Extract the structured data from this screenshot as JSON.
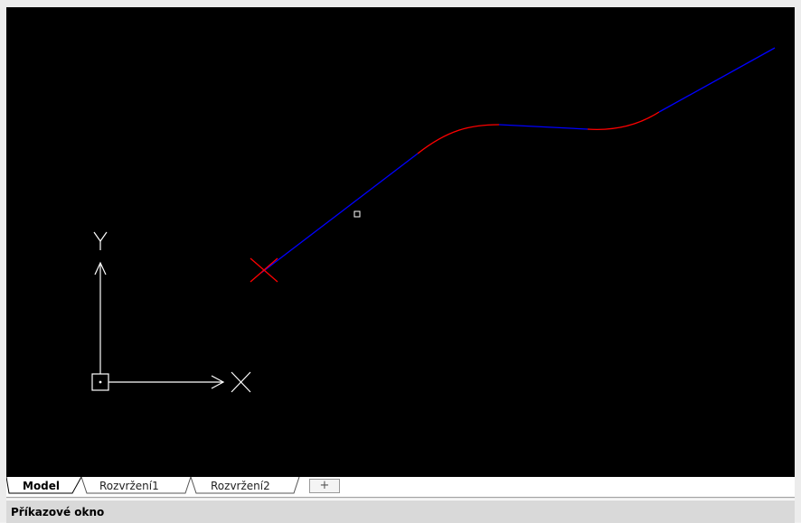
{
  "ucs_icon": {
    "x_label": "X",
    "y_label": "Y"
  },
  "tabs": [
    {
      "label": "Model",
      "active": true
    },
    {
      "label": "Rozvržení1",
      "active": false
    },
    {
      "label": "Rozvržení2",
      "active": false
    }
  ],
  "add_tab_label": "+",
  "command_window": {
    "title": "Příkazové okno"
  },
  "colors": {
    "canvas_bg": "#000000",
    "line_color": "#0000ff",
    "arc_color": "#ff0000",
    "start_marker_color": "#ff0000",
    "ucs_color": "#ffffff"
  }
}
